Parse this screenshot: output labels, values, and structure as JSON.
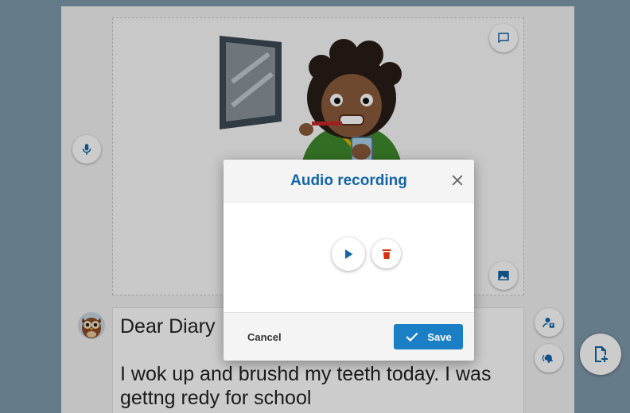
{
  "diary": {
    "text_lines": [
      "Dear Diary",
      "",
      "I wok up and brushd my teeth today. I was",
      "gettng redy for school"
    ]
  },
  "page_buttons": {
    "comment_icon": "comment-icon",
    "mic_icon": "microphone-icon",
    "image_icon": "image-icon",
    "close_icon": "close-icon",
    "speech_to_text_icon": "voice-text-icon",
    "read_aloud_icon": "speak-icon",
    "add_page_icon": "add-page-icon"
  },
  "modal": {
    "title": "Audio recording",
    "cancel_label": "Cancel",
    "save_label": "Save",
    "play_icon": "play-icon",
    "delete_icon": "trash-icon"
  },
  "colors": {
    "background": "#7f9aac",
    "accent_blue": "#1565a6",
    "save_button": "#1a7fc4",
    "delete_red": "#d32f0b"
  }
}
